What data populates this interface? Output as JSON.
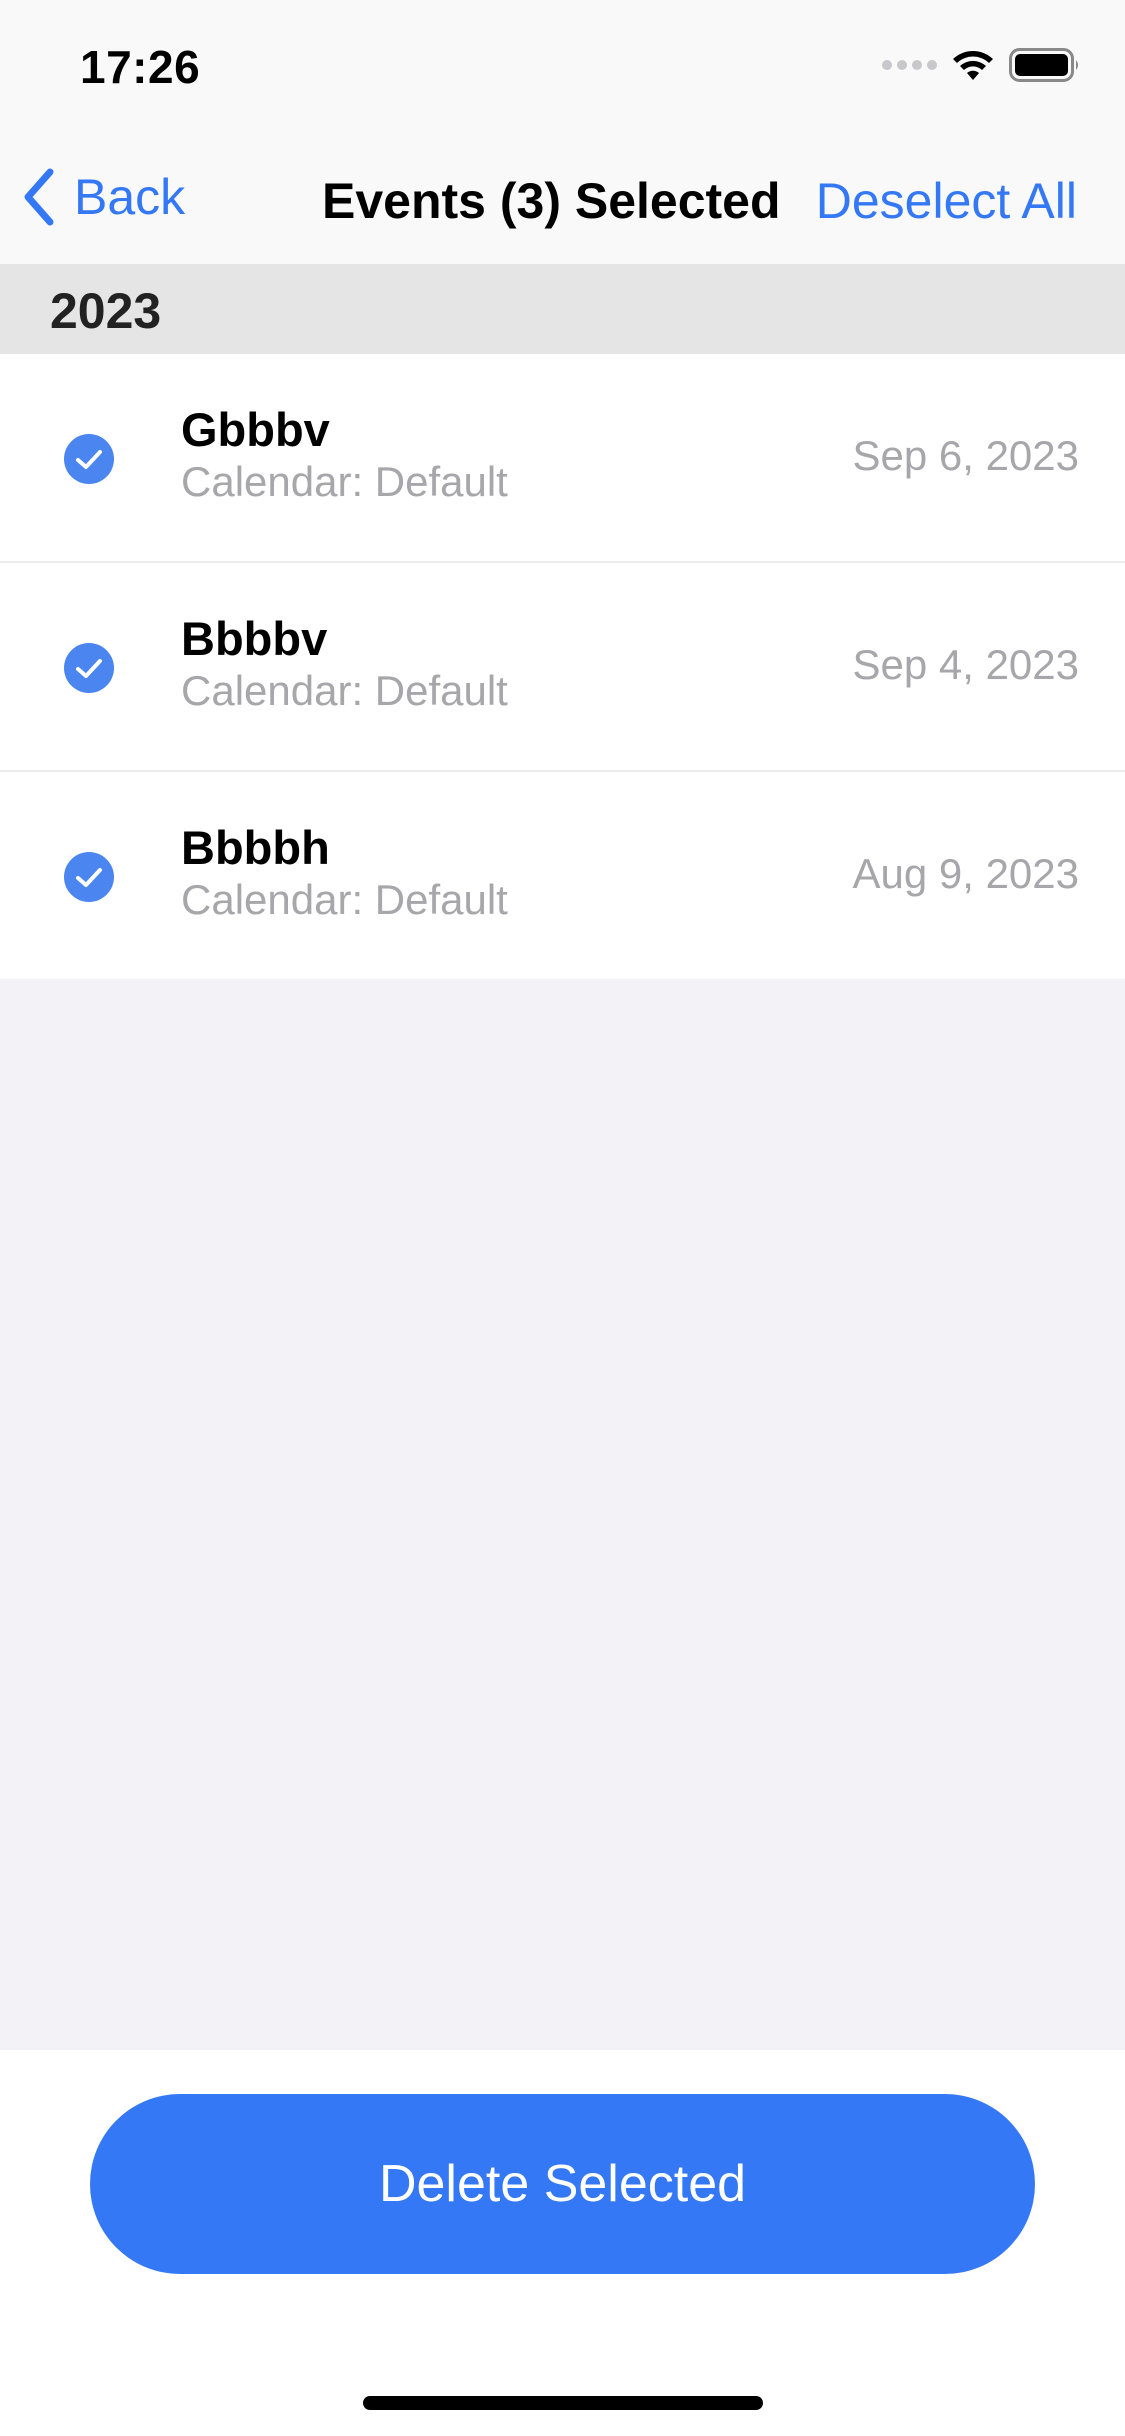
{
  "status_bar": {
    "time": "17:26"
  },
  "nav": {
    "back_label": "Back",
    "title": "Events (3) Selected",
    "deselect_label": "Deselect All"
  },
  "section": {
    "year": "2023"
  },
  "events": [
    {
      "title": "Gbbbv",
      "calendar": "Calendar:  Default",
      "date": "Sep 6, 2023",
      "selected": true
    },
    {
      "title": "Bbbbv",
      "calendar": "Calendar:  Default",
      "date": "Sep 4, 2023",
      "selected": true
    },
    {
      "title": "Bbbbh",
      "calendar": "Calendar:  Default",
      "date": "Aug 9, 2023",
      "selected": true
    }
  ],
  "footer": {
    "delete_label": "Delete Selected"
  },
  "colors": {
    "accent": "#3478f6",
    "check": "#4a85f0",
    "secondary_text": "#a6a6ab",
    "section_bg": "#e5e5e5",
    "page_bg": "#f2f2f7"
  },
  "icons": {
    "back": "chevron-left-icon",
    "check": "checkmark-circle-icon",
    "wifi": "wifi-icon",
    "battery": "battery-icon",
    "signal": "cellular-signal-icon"
  }
}
